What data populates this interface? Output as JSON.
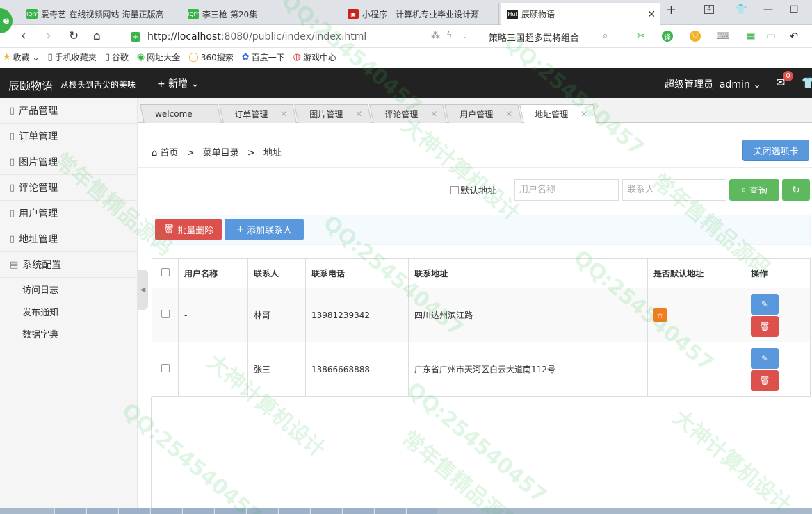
{
  "browser": {
    "tabs": [
      {
        "label": "爱奇艺-在线视频网站-海量正版高",
        "icon": "iqiyi-icon"
      },
      {
        "label": "李三枪 第20集",
        "icon": "iqiyi-icon"
      },
      {
        "label": "小程序 - 计算机专业毕业设计源",
        "icon": "mini-program-icon"
      },
      {
        "label": "辰颐物语",
        "icon": "hui-icon"
      }
    ],
    "favicon_labels": {
      "iqiyi": "iQIY",
      "hui": "Hui"
    },
    "tab_count": "4",
    "url_prefix": "http://",
    "url_host": "localhost",
    "url_path": ":8080/public/index/index.html",
    "search_query": "策略三国超多武将组合",
    "bookmarks": [
      "收藏",
      "手机收藏夹",
      "谷歌",
      "网址大全",
      "360搜索",
      "百度一下",
      "游戏中心"
    ]
  },
  "header": {
    "brand": "辰颐物语",
    "slogan": "从枝头到舌尖的美味",
    "new_label": "+ 新增",
    "user_role": "超级管理员",
    "username": "admin",
    "mail_badge": "0"
  },
  "sidebar": {
    "items": [
      {
        "label": "产品管理",
        "icon": "file-icon"
      },
      {
        "label": "订单管理",
        "icon": "file-icon"
      },
      {
        "label": "图片管理",
        "icon": "file-icon"
      },
      {
        "label": "评论管理",
        "icon": "file-icon"
      },
      {
        "label": "用户管理",
        "icon": "file-icon"
      },
      {
        "label": "地址管理",
        "icon": "file-icon"
      },
      {
        "label": "系统配置",
        "icon": "settings-icon"
      }
    ],
    "sub_items": [
      "访问日志",
      "发布通知",
      "数据字典"
    ]
  },
  "tabs": [
    {
      "label": "welcome"
    },
    {
      "label": "订单管理"
    },
    {
      "label": "图片管理"
    },
    {
      "label": "评论管理"
    },
    {
      "label": "用户管理"
    },
    {
      "label": "地址管理",
      "active": true
    }
  ],
  "breadcrumb": {
    "home": "首页",
    "menu": "菜单目录",
    "current": "地址"
  },
  "close_tabs_label": "关闭选项卡",
  "filter": {
    "default_label": "默认地址",
    "username_placeholder": "用户名称",
    "contact_placeholder": "联系人",
    "query_label": "查询"
  },
  "actions": {
    "batch_delete": "批量删除",
    "add_contact": "添加联系人"
  },
  "table": {
    "columns": [
      "用户名称",
      "联系人",
      "联系电话",
      "联系地址",
      "是否默认地址",
      "操作"
    ],
    "rows": [
      {
        "username": "-",
        "contact": "林哥",
        "phone": "13981239342",
        "address": "四川达州滨江路",
        "is_default": true
      },
      {
        "username": "-",
        "contact": "张三",
        "phone": "13866668888",
        "address": "广东省广州市天河区白云大道南112号",
        "is_default": false
      }
    ]
  },
  "watermarks": [
    "QQ:254540457",
    "常年售精品源码",
    "大神计算机设计"
  ],
  "colors": {
    "primary": "#5a98de",
    "danger": "#dd514c",
    "success": "#5eb95e",
    "warning": "#f37b1d",
    "header_bg": "#222222",
    "watermark": "#3cbe5a"
  }
}
